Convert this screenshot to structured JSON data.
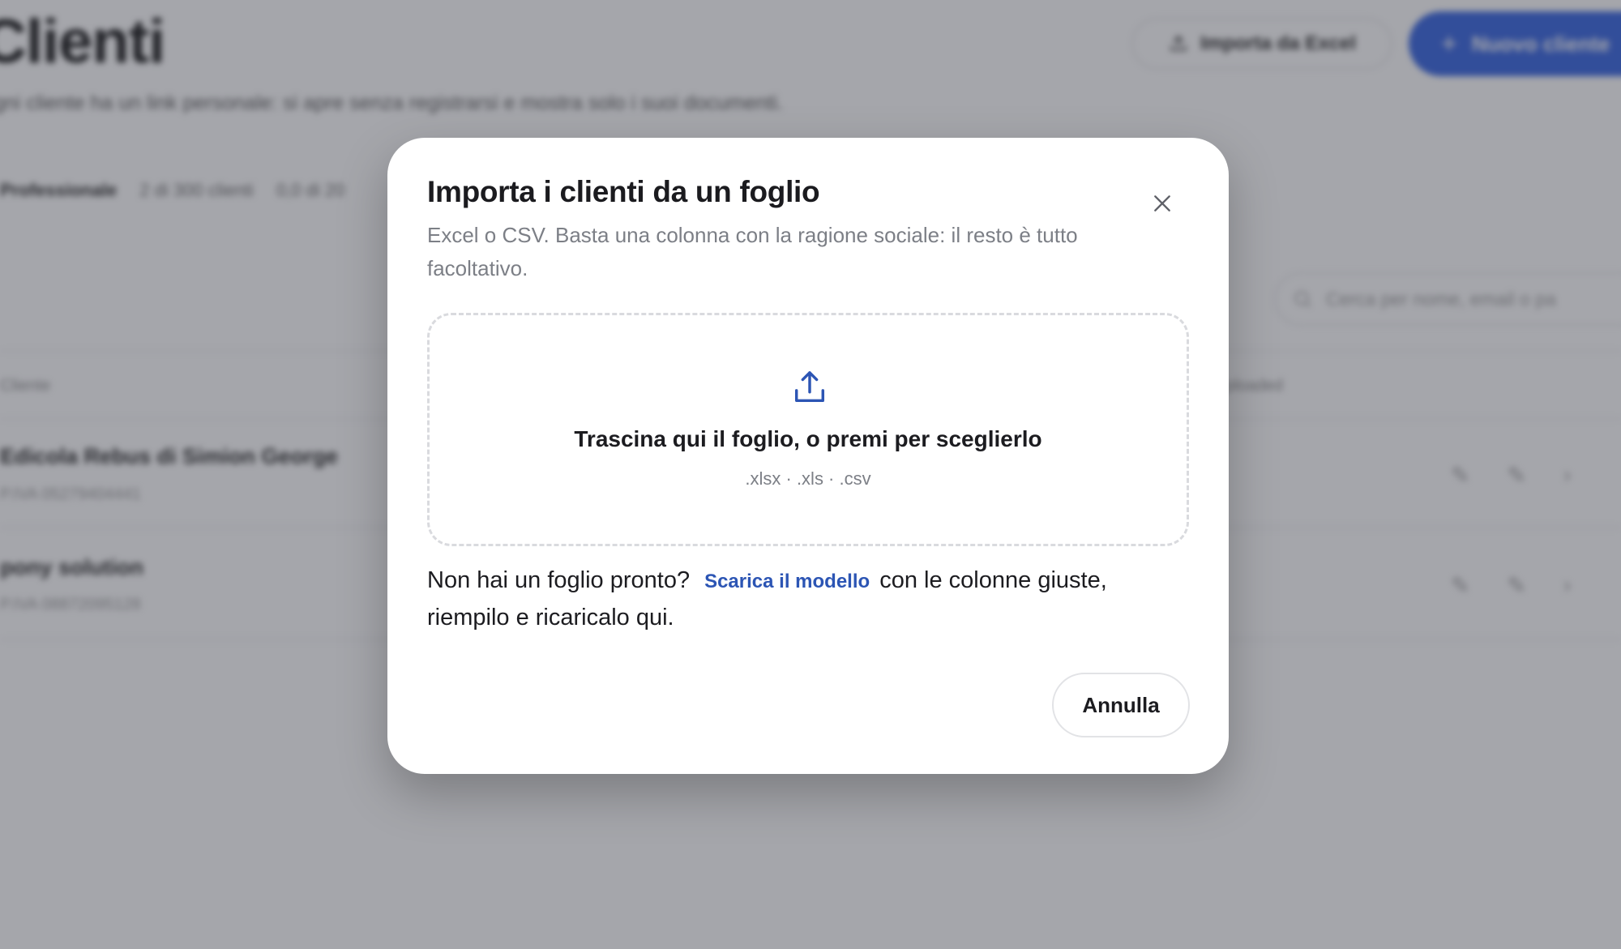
{
  "background": {
    "page_title": "Clienti",
    "page_subtitle": "gni cliente ha un link personale: si apre senza registrarsi e mostra solo i suoi documenti.",
    "import_button_label": "Importa da Excel",
    "new_client_button_label": "Nuovo cliente",
    "plan_label": "Professionale",
    "plan_usage": "2 di 300 clienti",
    "plan_storage": "0,0 di 20",
    "search_placeholder": "Cerca per nome, email o pa",
    "column_client": "Cliente",
    "column_documents": "ploaded",
    "rows": [
      {
        "name": "Edicola Rebus di Simion George",
        "sub": "P.IVA 05279404441"
      },
      {
        "name": "pony solution",
        "sub": "P.IVA 08872095128"
      }
    ]
  },
  "modal": {
    "title": "Importa i clienti da un foglio",
    "description": "Excel o CSV. Basta una colonna con la ragione sociale: il resto è tutto facoltativo.",
    "dropzone_main": "Trascina qui il foglio, o premi per sceglierlo",
    "dropzone_formats": ".xlsx · .xls · .csv",
    "help_prefix": "Non hai un foglio pronto?",
    "help_link": "Scarica il modello",
    "help_suffix": "con le colonne giuste, riempilo e ricaricalo qui.",
    "cancel_label": "Annulla"
  },
  "colors": {
    "accent": "#2f5fe0",
    "link": "#2c55b4",
    "overlay": "#373a44"
  },
  "icons": [
    "upload-icon",
    "close-icon",
    "plus-icon",
    "search-icon",
    "edit-icon",
    "chevron-right-icon"
  ]
}
